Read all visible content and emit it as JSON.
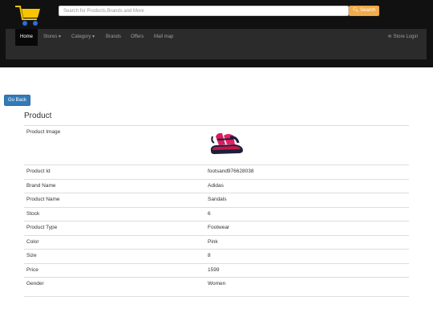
{
  "header": {
    "search": {
      "placeholder": "Search for Products,Brands and More",
      "button_label": "Search"
    }
  },
  "nav": {
    "items": [
      {
        "label": "Home"
      },
      {
        "label": "Stores ▾"
      },
      {
        "label": "Category ▾"
      },
      {
        "label": "Brands"
      },
      {
        "label": "Offers"
      },
      {
        "label": "Mall map"
      }
    ],
    "store_login_label": "⎆ Store Login"
  },
  "actions": {
    "go_back_label": "Go Back"
  },
  "product": {
    "title": "Product",
    "image_label": "Product Image",
    "image_icon": "sandal-product-photo",
    "rows": [
      {
        "label": "Product Id",
        "value": "footsand976628038"
      },
      {
        "label": "Brand Name",
        "value": "Adidas"
      },
      {
        "label": "Product Name",
        "value": "Sandals"
      },
      {
        "label": "Stock",
        "value": "6"
      },
      {
        "label": "Product Type",
        "value": "Footwear"
      },
      {
        "label": "Color",
        "value": "Pink"
      },
      {
        "label": "Size",
        "value": "8"
      },
      {
        "label": "Price",
        "value": "1599"
      },
      {
        "label": "Gender",
        "value": "Women"
      }
    ]
  },
  "colors": {
    "topbar": "#111111",
    "navbar": "#2b2b2b",
    "search_button": "#f0ad4e",
    "go_back_button": "#337ab7",
    "logo_cart": "#f7c600"
  }
}
